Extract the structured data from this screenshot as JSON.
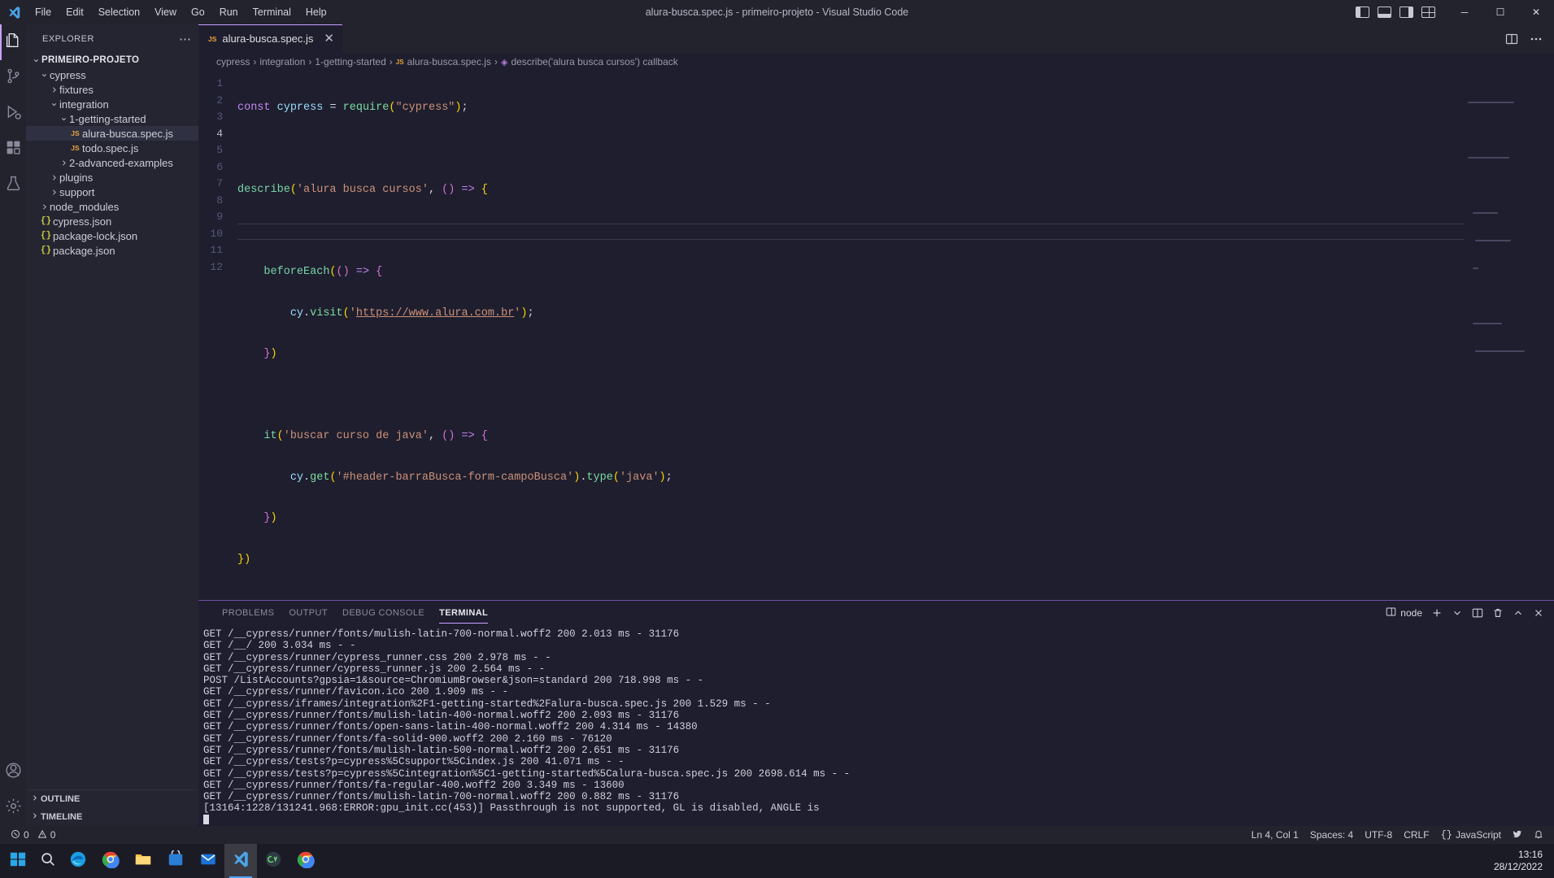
{
  "titlebar": {
    "logo_icon": "vscode-logo-icon",
    "menu": [
      "File",
      "Edit",
      "Selection",
      "View",
      "Go",
      "Run",
      "Terminal",
      "Help"
    ],
    "window_title": "alura-busca.spec.js - primeiro-projeto - Visual Studio Code",
    "layout_icons": [
      "toggle-primary-sidebar-icon",
      "toggle-panel-icon",
      "toggle-secondary-sidebar-icon",
      "customize-layout-icon"
    ],
    "window_buttons": {
      "minimize": "─",
      "maximize": "☐",
      "close": "✕"
    }
  },
  "activitybar": {
    "items": [
      {
        "name": "explorer",
        "icon": "files-icon",
        "active": true
      },
      {
        "name": "source-control",
        "icon": "source-control-icon",
        "active": false
      },
      {
        "name": "run-and-debug",
        "icon": "debug-icon",
        "active": false
      },
      {
        "name": "extensions",
        "icon": "extensions-icon",
        "active": false
      },
      {
        "name": "testing",
        "icon": "beaker-icon",
        "active": false
      }
    ],
    "bottom": [
      {
        "name": "accounts",
        "icon": "account-icon"
      },
      {
        "name": "manage",
        "icon": "gear-icon"
      }
    ]
  },
  "sidebar": {
    "title": "EXPLORER",
    "more_actions_icon": "ellipsis-icon",
    "tree": [
      {
        "label": "PRIMEIRO-PROJETO",
        "depth": 0,
        "kind": "root",
        "expanded": true
      },
      {
        "label": "cypress",
        "depth": 1,
        "kind": "folder",
        "expanded": true
      },
      {
        "label": "fixtures",
        "depth": 2,
        "kind": "folder",
        "expanded": false
      },
      {
        "label": "integration",
        "depth": 2,
        "kind": "folder",
        "expanded": true
      },
      {
        "label": "1-getting-started",
        "depth": 3,
        "kind": "folder",
        "expanded": true
      },
      {
        "label": "alura-busca.spec.js",
        "depth": 4,
        "kind": "js",
        "selected": true
      },
      {
        "label": "todo.spec.js",
        "depth": 4,
        "kind": "js"
      },
      {
        "label": "2-advanced-examples",
        "depth": 3,
        "kind": "folder",
        "expanded": false
      },
      {
        "label": "plugins",
        "depth": 2,
        "kind": "folder",
        "expanded": false
      },
      {
        "label": "support",
        "depth": 2,
        "kind": "folder",
        "expanded": false
      },
      {
        "label": "node_modules",
        "depth": 1,
        "kind": "folder",
        "expanded": false
      },
      {
        "label": "cypress.json",
        "depth": 1,
        "kind": "json"
      },
      {
        "label": "package-lock.json",
        "depth": 1,
        "kind": "json"
      },
      {
        "label": "package.json",
        "depth": 1,
        "kind": "json"
      }
    ],
    "panels": [
      {
        "label": "OUTLINE",
        "expanded": false
      },
      {
        "label": "TIMELINE",
        "expanded": false
      }
    ]
  },
  "editor": {
    "tab": {
      "label": "alura-busca.spec.js",
      "icon": "js-file-icon",
      "close_icon": "close-icon",
      "active": true
    },
    "tab_actions": [
      "split-editor-icon",
      "more-actions-icon"
    ],
    "breadcrumbs": [
      {
        "label": "cypress",
        "icon": ""
      },
      {
        "label": "integration",
        "icon": ""
      },
      {
        "label": "1-getting-started",
        "icon": ""
      },
      {
        "label": "alura-busca.spec.js",
        "icon": "js-file-icon"
      },
      {
        "label": "describe('alura busca cursos') callback",
        "icon": "symbol-event-icon"
      }
    ],
    "line_numbers": [
      1,
      2,
      3,
      4,
      5,
      6,
      7,
      8,
      9,
      10,
      11,
      12
    ],
    "active_line": 4,
    "code_lines": [
      "const cypress = require(\"cypress\");",
      "",
      "describe('alura busca cursos', () => {",
      "",
      "    beforeEach(() => {",
      "        cy.visit('https://www.alura.com.br');",
      "    })",
      "",
      "    it('buscar curso de java', () => {",
      "        cy.get('#header-barraBusca-form-campoBusca').type('java');",
      "    })",
      "})"
    ]
  },
  "panel": {
    "tabs": [
      {
        "label": "PROBLEMS",
        "active": false
      },
      {
        "label": "OUTPUT",
        "active": false
      },
      {
        "label": "DEBUG CONSOLE",
        "active": false
      },
      {
        "label": "TERMINAL",
        "active": true
      }
    ],
    "terminal_selector": "node",
    "actions": [
      "new-terminal-icon",
      "chevron-down-icon",
      "split-terminal-icon",
      "kill-terminal-icon",
      "close-panel-icon",
      "maximize-panel-icon"
    ],
    "terminal_lines": [
      "GET /__cypress/runner/fonts/mulish-latin-700-normal.woff2 200 2.013 ms - 31176",
      "GET /__/ 200 3.034 ms - -",
      "GET /__cypress/runner/cypress_runner.css 200 2.978 ms - -",
      "GET /__cypress/runner/cypress_runner.js 200 2.564 ms - -",
      "POST /ListAccounts?gpsia=1&source=ChromiumBrowser&json=standard 200 718.998 ms - -",
      "GET /__cypress/runner/favicon.ico 200 1.909 ms - -",
      "GET /__cypress/iframes/integration%2F1-getting-started%2Falura-busca.spec.js 200 1.529 ms - -",
      "GET /__cypress/runner/fonts/mulish-latin-400-normal.woff2 200 2.093 ms - 31176",
      "GET /__cypress/runner/fonts/open-sans-latin-400-normal.woff2 200 4.314 ms - 14380",
      "GET /__cypress/runner/fonts/fa-solid-900.woff2 200 2.160 ms - 76120",
      "GET /__cypress/runner/fonts/mulish-latin-500-normal.woff2 200 2.651 ms - 31176",
      "GET /__cypress/tests?p=cypress%5Csupport%5Cindex.js 200 41.071 ms - -",
      "GET /__cypress/tests?p=cypress%5Cintegration%5C1-getting-started%5Calura-busca.spec.js 200 2698.614 ms - -",
      "GET /__cypress/runner/fonts/fa-regular-400.woff2 200 3.349 ms - 13600",
      "GET /__cypress/runner/fonts/mulish-latin-700-normal.woff2 200 0.882 ms - 31176",
      "[13164:1228/131241.968:ERROR:gpu_init.cc(453)] Passthrough is not supported, GL is disabled, ANGLE is"
    ]
  },
  "statusbar": {
    "left": [
      {
        "name": "remote-indicator",
        "label": "",
        "icon": "remote-icon"
      },
      {
        "name": "problems",
        "label": "0",
        "icon": "error-icon"
      },
      {
        "name": "warnings",
        "label": "0",
        "icon": "warning-icon"
      }
    ],
    "errors_count": "0",
    "warnings_count": "0",
    "right": [
      {
        "name": "cursor-position",
        "label": "Ln 4, Col 1"
      },
      {
        "name": "indentation",
        "label": "Spaces: 4"
      },
      {
        "name": "encoding",
        "label": "UTF-8"
      },
      {
        "name": "eol",
        "label": "CRLF"
      },
      {
        "name": "language-mode",
        "label": "JavaScript"
      },
      {
        "name": "feedback",
        "label": "",
        "icon": "tweet-icon"
      },
      {
        "name": "notifications",
        "label": "",
        "icon": "bell-icon"
      }
    ]
  },
  "taskbar": {
    "items": [
      {
        "name": "start-button",
        "icon": "windows-logo-icon"
      },
      {
        "name": "search-button",
        "icon": "search-icon"
      },
      {
        "name": "taskview-button",
        "icon": "taskview-icon"
      },
      {
        "name": "edge-app",
        "icon": "edge-icon"
      },
      {
        "name": "chrome-app",
        "icon": "chrome-icon"
      },
      {
        "name": "explorer-app",
        "icon": "folder-icon"
      },
      {
        "name": "store-app",
        "icon": "store-icon"
      },
      {
        "name": "mail-app",
        "icon": "mail-icon"
      },
      {
        "name": "vscode-app",
        "icon": "vscode-icon",
        "active": true
      },
      {
        "name": "cypress-app",
        "icon": "cypress-icon"
      },
      {
        "name": "chrome-window",
        "icon": "chrome-icon"
      }
    ],
    "clock_time": "13:16",
    "clock_date": "28/12/2022"
  }
}
